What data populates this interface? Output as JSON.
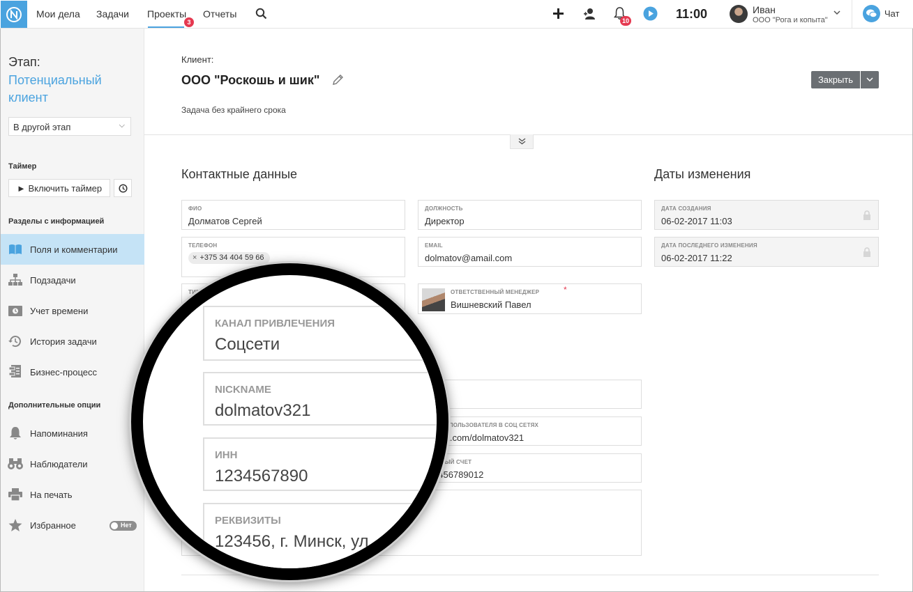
{
  "topbar": {
    "nav": [
      "Мои дела",
      "Задачи",
      "Проекты",
      "Отчеты"
    ],
    "projects_badge": "3",
    "notifications_badge": "10",
    "time": "11:00",
    "user_name": "Иван",
    "user_org": "ООО \"Рога и копыта\"",
    "chat_label": "Чат",
    "accent_color": "#4aa3df"
  },
  "sidebar": {
    "stage_label": "Этап:",
    "stage_value": "Потенциальный клиент",
    "stage_select": "В другой этап",
    "timer_title": "Таймер",
    "timer_button": "► Включить таймер",
    "sections_title": "Разделы с информацией",
    "sections": [
      "Поля и комментарии",
      "Подзадачи",
      "Учет времени",
      "История задачи",
      "Бизнес-процесс"
    ],
    "options_title": "Дополнительные опции",
    "options": [
      "Напоминания",
      "Наблюдатели",
      "На печать",
      "Избранное"
    ],
    "favorite_toggle": "Нет"
  },
  "main": {
    "client_label": "Клиент:",
    "client_name": "ООО \"Роскошь и шик\"",
    "deadline": "Задача без крайнего срока",
    "close_button": "Закрыть",
    "contacts_title": "Контактные данные",
    "dates_title": "Даты изменения",
    "fields": {
      "fio_label": "ФИО",
      "fio_value": "Долматов Сергей",
      "position_label": "Должность",
      "position_value": "Директор",
      "phone_label": "Телефон",
      "phone_value": "+375 34 404 59 66",
      "email_label": "Email",
      "email_value": "dolmatov@amail.com",
      "type_label": "ТИП",
      "manager_label": "Ответственный менеджер",
      "manager_value": "Вишневский Павел",
      "social_label": "А НА ПОЛЬЗОВАТЕЛЯ В СОЦ СЕТЯХ",
      "social_value": "://vk.com/dolmatov321",
      "account_label": "ЕТНЫЙ СЧЕТ",
      "account_value": "3456789012"
    },
    "dates": {
      "created_label": "Дата создания",
      "created_value": "06-02-2017 11:03",
      "modified_label": "Дата последнего изменения",
      "modified_value": "06-02-2017 11:22"
    }
  },
  "magnifier": {
    "channel_label": "Канал привлечения",
    "channel_value": "Соцсети",
    "nickname_label": "Nickname",
    "nickname_value": "dolmatov321",
    "inn_label": "ИНН",
    "inn_value": "1234567890",
    "requisites_label": "Реквизиты",
    "requisites_value": "123456, г. Минск, ул"
  }
}
